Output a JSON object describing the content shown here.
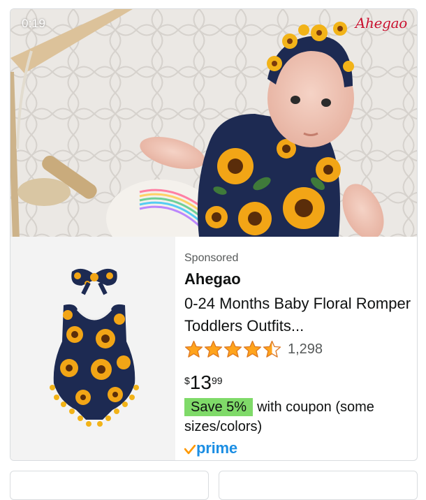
{
  "video": {
    "timestamp": "0:19",
    "logo_text": "Ahegao"
  },
  "product": {
    "sponsored_label": "Sponsored",
    "brand": "Ahegao",
    "title": "0-24 Months Baby Floral Romper Toddlers Outfits...",
    "rating": {
      "stars": 4.5,
      "max_stars": 5,
      "count": "1,298"
    },
    "price": {
      "symbol": "$",
      "whole": "13",
      "fraction": "99"
    },
    "coupon": {
      "badge": "Save 5%",
      "text": "with coupon (some sizes/colors)"
    },
    "prime_label": "prime"
  },
  "colors": {
    "star": "#ffa41c",
    "prime_blue": "#1b8ee3",
    "prime_check": "#ff9900",
    "coupon_badge": "#7fda69",
    "logo_red": "#c8102e"
  },
  "icons": [
    "star-icon",
    "prime-check-icon",
    "play-timer"
  ]
}
